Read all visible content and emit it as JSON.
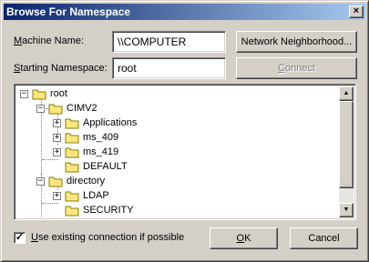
{
  "window": {
    "title": "Browse For Namespace",
    "close_glyph": "×"
  },
  "machine": {
    "label_u": "M",
    "label_rest": "achine Name:",
    "value": "\\\\COMPUTER"
  },
  "namespace": {
    "label_u": "S",
    "label_rest": "tarting Namespace:",
    "value": "root"
  },
  "buttons": {
    "network": "Network Neighborhood...",
    "connect_u": "C",
    "connect_rest": "onnect",
    "ok_u": "O",
    "ok_rest": "K",
    "cancel": "Cancel"
  },
  "tree": {
    "items": [
      {
        "label": "root",
        "expander": "−"
      },
      {
        "label": "CIMV2",
        "expander": "−"
      },
      {
        "label": "Applications",
        "expander": "+"
      },
      {
        "label": "ms_409",
        "expander": "+"
      },
      {
        "label": "ms_419",
        "expander": "+"
      },
      {
        "label": "DEFAULT",
        "expander": ""
      },
      {
        "label": "directory",
        "expander": "−"
      },
      {
        "label": "LDAP",
        "expander": "+"
      },
      {
        "label": "SECURITY",
        "expander": ""
      }
    ]
  },
  "scroll": {
    "up_glyph": "▲",
    "down_glyph": "▼"
  },
  "option": {
    "checked_glyph": "✓",
    "label_u": "U",
    "label_rest": "se existing connection if possible",
    "checked": true
  },
  "colors": {
    "title_start": "#0a246a",
    "title_end": "#a6caf0",
    "folder": "#ffe680",
    "folder_edge": "#808000"
  }
}
